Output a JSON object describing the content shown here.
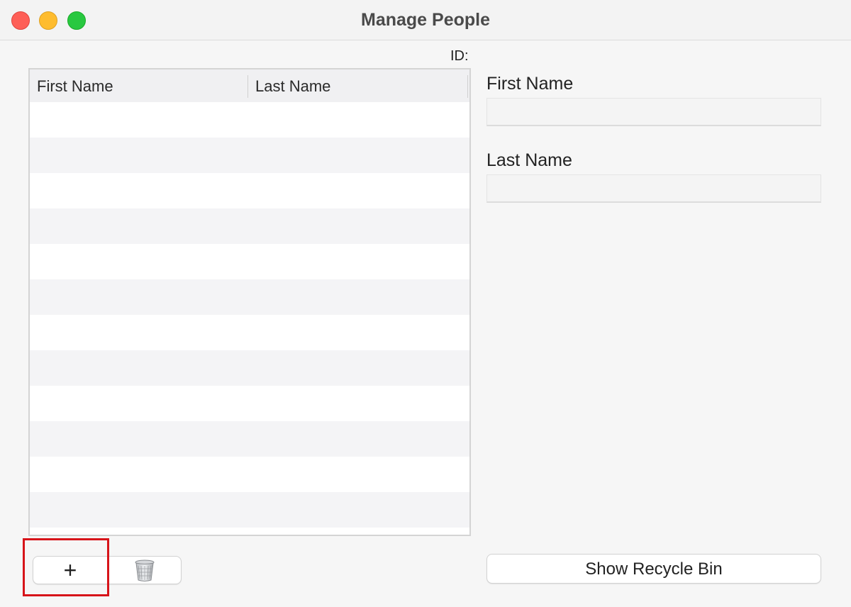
{
  "window": {
    "title": "Manage People"
  },
  "detail": {
    "id_label": "ID:",
    "first_name_label": "First Name",
    "first_name_value": "",
    "last_name_label": "Last Name",
    "last_name_value": ""
  },
  "table": {
    "columns": [
      "First Name",
      "Last Name"
    ],
    "rows": []
  },
  "toolbar": {
    "add_label": "+",
    "delete_icon": "trash-icon",
    "recycle_label": "Show Recycle Bin"
  },
  "colors": {
    "close": "#fe5f57",
    "minimize": "#febc2e",
    "maximize": "#28c840",
    "highlight": "#d7141a"
  }
}
